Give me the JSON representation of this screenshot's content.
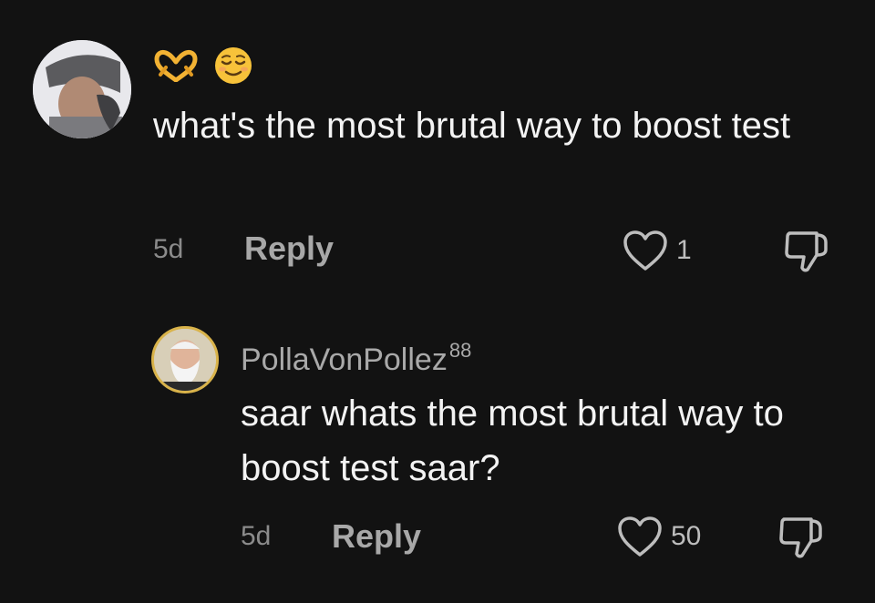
{
  "comments": [
    {
      "author_emojis": [
        "heart-hands",
        "relieved-face"
      ],
      "text": "what's the most brutal way to boost test",
      "time": "5d",
      "reply_label": "Reply",
      "likes": "1"
    },
    {
      "username": "PollaVonPollez",
      "username_superscript": "88",
      "text": "saar whats the most brutal way to boost test saar?",
      "time": "5d",
      "reply_label": "Reply",
      "likes": "50"
    }
  ],
  "colors": {
    "background": "#121212",
    "text": "#f3f3f3",
    "muted": "#8b8b8b",
    "reply": "#a8a8a8",
    "avatar_ring": "#d9b34a"
  }
}
